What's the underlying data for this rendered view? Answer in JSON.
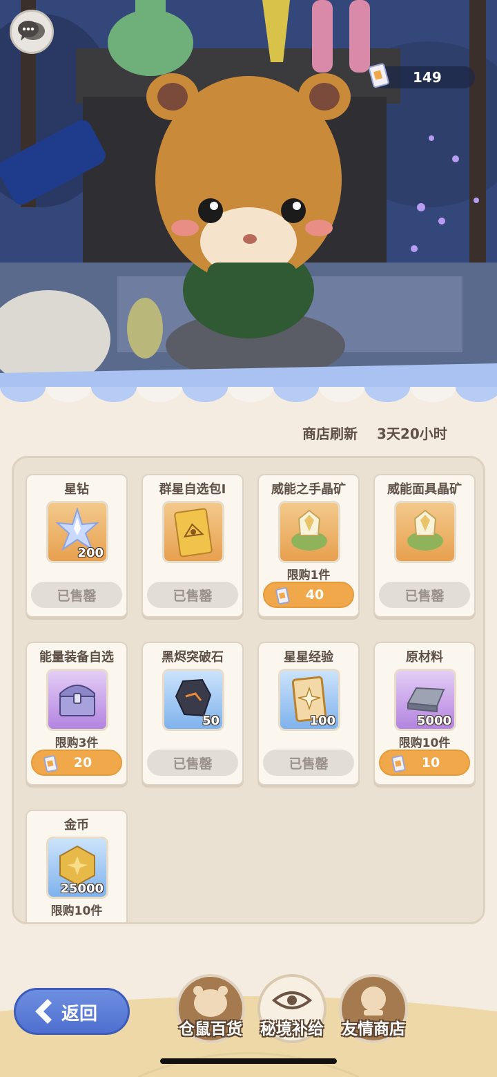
{
  "currency": {
    "amount": "149",
    "icon": "ticket-icon"
  },
  "shop": {
    "refresh_label": "商店刷新",
    "refresh_time": "3天20小时"
  },
  "items": [
    {
      "name": "星钻",
      "qty": "200",
      "color": "orange",
      "icon": "star-diamond-icon",
      "limit": "",
      "status": "已售罄",
      "price": ""
    },
    {
      "name": "群星自选包Ⅰ",
      "qty": "",
      "color": "orange",
      "icon": "card-pack-icon",
      "limit": "",
      "status": "已售罄",
      "price": ""
    },
    {
      "name": "威能之手晶矿",
      "qty": "",
      "color": "orange",
      "icon": "crystal-ore-icon",
      "limit": "限购1件",
      "status": "",
      "price": "40"
    },
    {
      "name": "威能面具晶矿",
      "qty": "",
      "color": "orange",
      "icon": "crystal-ore-icon",
      "limit": "",
      "status": "已售罄",
      "price": ""
    },
    {
      "name": "能量装备自选",
      "qty": "",
      "color": "purple",
      "icon": "treasure-chest-icon",
      "limit": "限购3件",
      "status": "",
      "price": "20"
    },
    {
      "name": "黑烬突破石",
      "qty": "50",
      "color": "blue",
      "icon": "ember-stone-icon",
      "limit": "",
      "status": "已售罄",
      "price": ""
    },
    {
      "name": "星星经验",
      "qty": "100",
      "color": "blue",
      "icon": "star-card-icon",
      "limit": "",
      "status": "已售罄",
      "price": ""
    },
    {
      "name": "原材料",
      "qty": "5000",
      "color": "purple",
      "icon": "metal-ingot-icon",
      "limit": "限购10件",
      "status": "",
      "price": "10"
    },
    {
      "name": "金币",
      "qty": "25000",
      "color": "blue",
      "icon": "gold-coin-icon",
      "limit": "限购10件",
      "status": "",
      "price": ""
    }
  ],
  "bottom": {
    "back_label": "返回",
    "tabs": [
      {
        "label": "仓鼠百货",
        "icon": "hamster-icon"
      },
      {
        "label": "秘境补给",
        "icon": "eye-emblem-icon"
      },
      {
        "label": "友情商店",
        "icon": "crystal-ball-icon"
      }
    ]
  }
}
